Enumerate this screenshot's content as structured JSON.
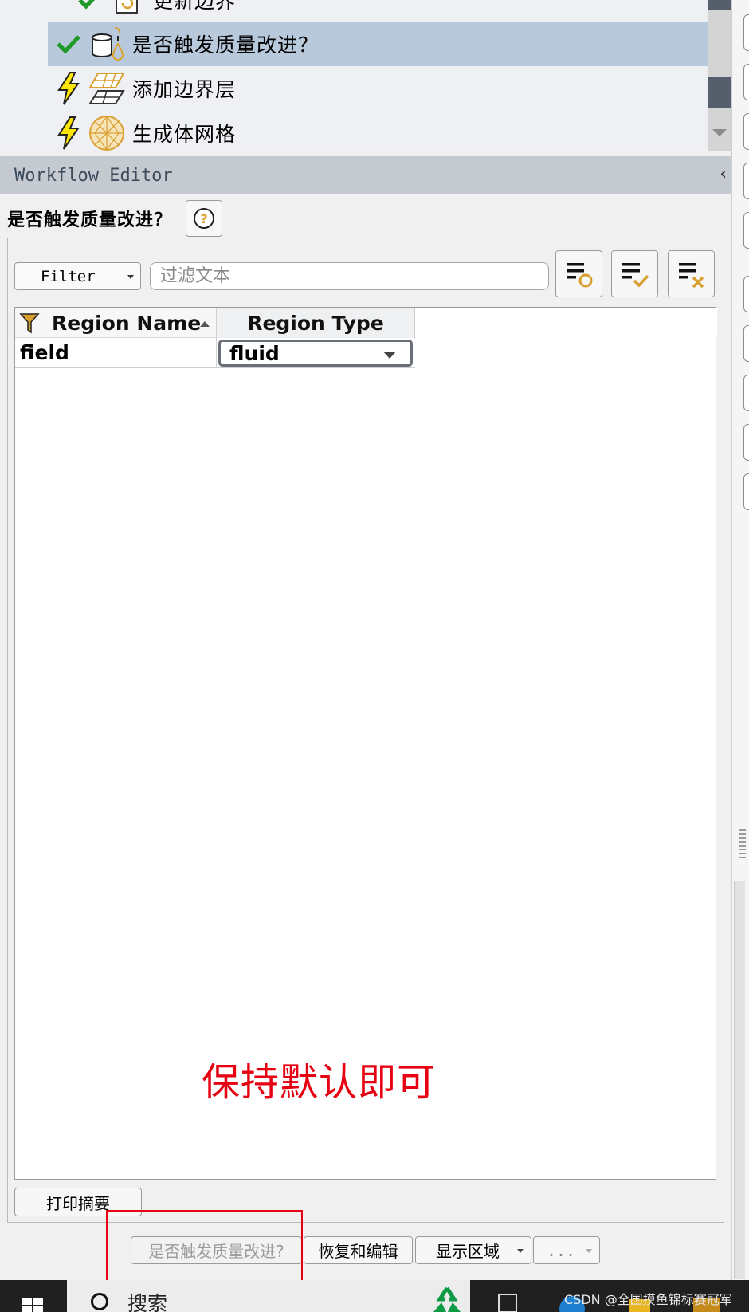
{
  "tree": {
    "items": [
      {
        "label": "更新边界",
        "status": "check-icon",
        "icon": "update-boundaries-icon"
      },
      {
        "label": "是否触发质量改进？",
        "status": "check-icon",
        "icon": "improve-quality-icon",
        "selected": true
      },
      {
        "label": "添加边界层",
        "status": "lightning-icon",
        "icon": "boundary-layer-icon"
      },
      {
        "label": "生成体网格",
        "status": "lightning-icon",
        "icon": "volume-mesh-icon"
      }
    ]
  },
  "editor": {
    "title": "Workflow Editor",
    "collapse": "‹",
    "task_title": "是否触发质量改进？"
  },
  "filter": {
    "dropdown_label": "Filter",
    "placeholder": "过滤文本",
    "value": ""
  },
  "table": {
    "headers": [
      "Region Name",
      "Region Type"
    ],
    "rows": [
      {
        "name": "field",
        "type": "fluid"
      }
    ]
  },
  "annotation": "保持默认即可",
  "buttons": {
    "print_summary": "打印摘要",
    "run": "是否触发质量改进?",
    "revert_edit": "恢复和编辑",
    "show_region": "显示区域",
    "more": "..."
  },
  "taskbar": {
    "search": "搜索"
  },
  "watermark": "CSDN @全国摸鱼锦标赛冠军",
  "colors": {
    "selected_row": "#b9c9dc",
    "header_bg": "#c5cad1",
    "annotation_red": "#e60012",
    "check_green": "#1f9a2a",
    "lightning_yellow": "#ffe600",
    "icon_orange": "#d9a030"
  }
}
